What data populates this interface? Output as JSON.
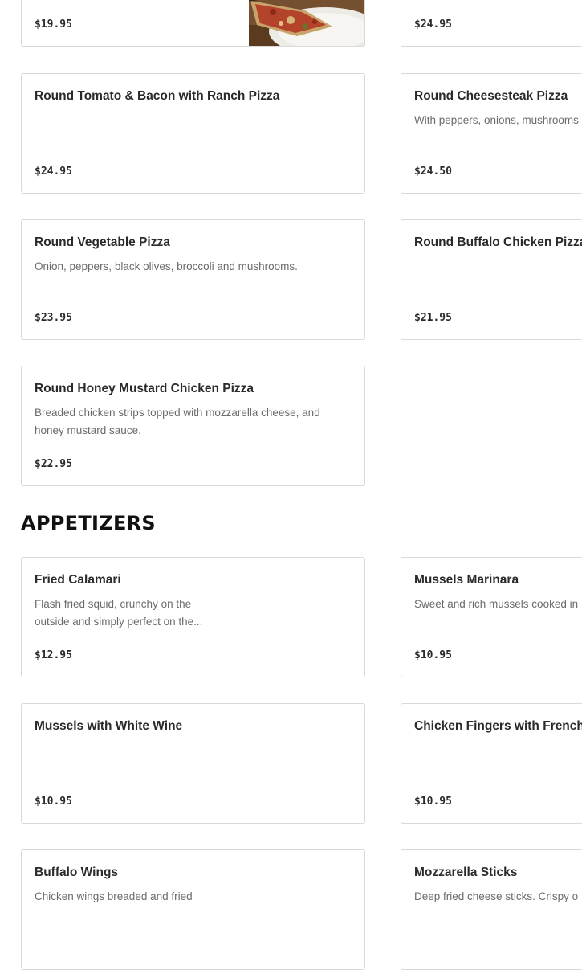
{
  "menu": {
    "top": {
      "left": {
        "price": "$19.95"
      },
      "right": {
        "price": "$24.95"
      }
    },
    "pizza_items": [
      {
        "name": "Round Tomato & Bacon with Ranch Pizza",
        "description": "",
        "price": "$24.95"
      },
      {
        "name": "Round Cheesesteak Pizza",
        "description": "With peppers, onions, mushrooms",
        "price": "$24.50"
      },
      {
        "name": "Round Vegetable Pizza",
        "description": "Onion, peppers, black olives, broccoli and mushrooms.",
        "price": "$23.95"
      },
      {
        "name": "Round Buffalo Chicken Pizza",
        "description": "",
        "price": "$21.95"
      },
      {
        "name": "Round Honey Mustard Chicken Pizza",
        "description": "Breaded chicken strips topped with mozzarella cheese, and honey mustard sauce.",
        "price": "$22.95"
      }
    ],
    "appetizers": {
      "title": "APPETIZERS",
      "items": [
        {
          "name": "Fried Calamari",
          "description": "Flash fried squid, crunchy on the outside and simply perfect on the...",
          "price": "$12.95"
        },
        {
          "name": "Mussels Marinara",
          "description": "Sweet and rich mussels cooked in",
          "price": "$10.95"
        },
        {
          "name": "Mussels with White Wine",
          "description": "",
          "price": "$10.95"
        },
        {
          "name": "Chicken Fingers with French",
          "description": "",
          "price": "$10.95"
        },
        {
          "name": "Buffalo Wings",
          "description": "Chicken wings breaded and fried",
          "price": ""
        },
        {
          "name": "Mozzarella Sticks",
          "description": "Deep fried cheese sticks. Crispy o",
          "price": ""
        }
      ]
    }
  }
}
